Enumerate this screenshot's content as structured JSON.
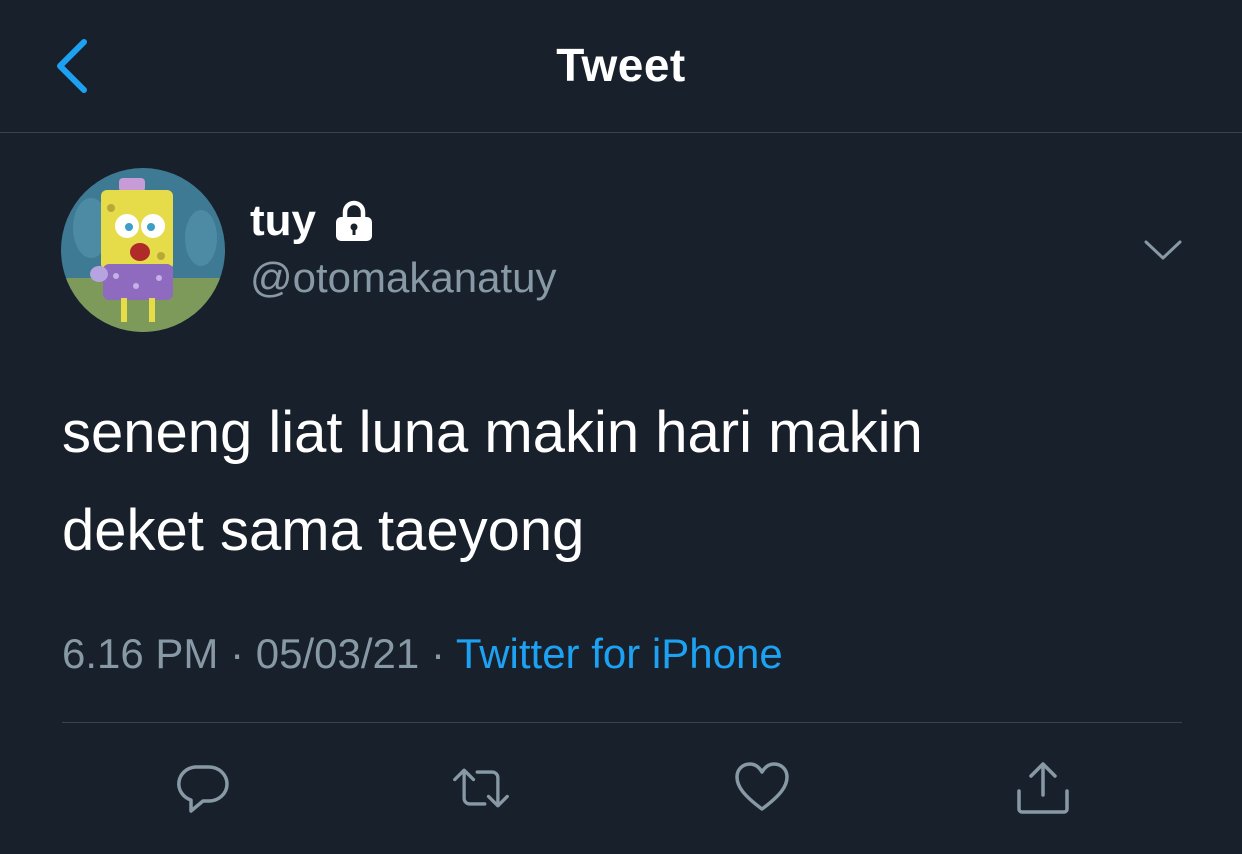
{
  "header": {
    "title": "Tweet",
    "back_icon": "chevron-left-icon"
  },
  "tweet": {
    "author": {
      "display_name": "tuy",
      "handle": "@otomakanatuy",
      "protected_icon": "lock-icon",
      "avatar_icon": "spongebob-avatar"
    },
    "text": "seneng liat luna makin hari makin\ndeket sama taeyong",
    "time": "6.16 PM",
    "date": "05/03/21",
    "separator": "·",
    "source": "Twitter for iPhone"
  },
  "actions": [
    {
      "icon": "reply-icon"
    },
    {
      "icon": "retweet-icon"
    },
    {
      "icon": "like-icon"
    },
    {
      "icon": "share-icon"
    }
  ],
  "colors": {
    "background": "#18202b",
    "accent": "#1da1f2",
    "secondary_text": "#8899a6",
    "divider": "#38444d",
    "icon": "#8899a6"
  }
}
